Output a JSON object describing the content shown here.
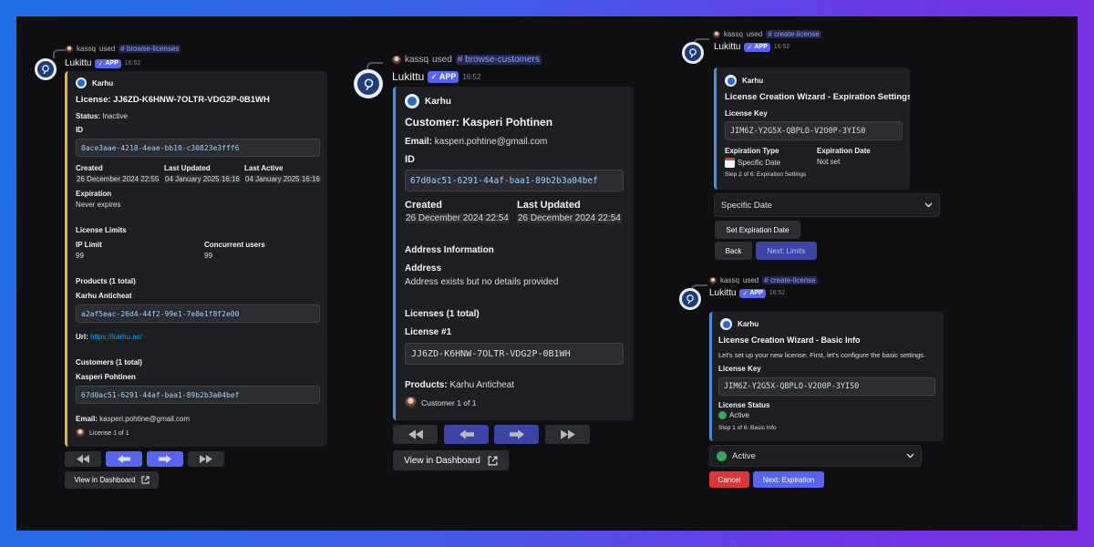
{
  "common": {
    "user": "kassq",
    "used_word": "used",
    "bot_name": "Lukittu",
    "app_badge": "APP",
    "embed_author": "Karhu",
    "time": "16:52"
  },
  "left": {
    "command": "browse-licenses",
    "title": "License: JJ6ZD-K6HNW-7OLTR-VDG2P-0B1WH",
    "status_label": "Status:",
    "status_value": "Inactive",
    "id_label": "ID",
    "id_value": "8ace3aae-4218-4eae-bb10-c30823e3fff6",
    "created_label": "Created",
    "created_value": "26 December 2024 22:55",
    "updated_label": "Last Updated",
    "updated_value": "04 January 2025 16:16",
    "active_label": "Last Active",
    "active_value": "04 January 2025 16:16",
    "expiration_label": "Expiration",
    "expiration_value": "Never expires",
    "limits_heading": "License Limits",
    "ip_limit_label": "IP Limit",
    "ip_limit_value": "99",
    "concurrent_label": "Concurrent users",
    "concurrent_value": "99",
    "products_heading": "Products (1 total)",
    "product_name": "Karhu Anticheat",
    "product_id": "a2af5eac-26d4-44f2-99e1-7e8e1f8f2e00",
    "url_label": "Url:",
    "url_value": "https://karhu.ac/",
    "customers_heading": "Customers (1 total)",
    "customer_name": "Kasperi Pohtinen",
    "customer_id": "67d0ac51-6291-44af-baa1-89b2b3a04bef",
    "email_label": "Email:",
    "email_value": "kasperi.pohtine@gmail.com",
    "footer": "License 1 of 1",
    "dashboard_button": "View in Dashboard"
  },
  "middle": {
    "command": "browse-customers",
    "title": "Customer: Kasperi Pohtinen",
    "email_label": "Email:",
    "email_value": "kasperi.pohtine@gmail.com",
    "id_label": "ID",
    "id_value": "67d0ac51-6291-44af-baa1-89b2b3a04bef",
    "created_label": "Created",
    "created_value": "26 December 2024 22:54",
    "updated_label": "Last Updated",
    "updated_value": "26 December 2024 22:54",
    "address_heading": "Address Information",
    "address_label": "Address",
    "address_value": "Address exists but no details provided",
    "licenses_heading": "Licenses (1 total)",
    "license_label": "License #1",
    "license_key": "JJ6ZD-K6HNW-7OLTR-VDG2P-0B1WH",
    "products_label": "Products:",
    "products_value": "Karhu Anticheat",
    "footer": "Customer 1 of 1",
    "dashboard_button": "View in Dashboard"
  },
  "right_top": {
    "command": "create-license",
    "title": "License Creation Wizard - Expiration Settings",
    "key_label": "License Key",
    "key_value": "JIM6Z-Y2G5X-QBPLO-V2O0P-3YIS0",
    "exp_type_label": "Expiration Type",
    "exp_type_value": "Specific Date",
    "exp_date_label": "Expiration Date",
    "exp_date_value": "Not set",
    "step": "Step 2 of 6: Expiration Settings",
    "select_value": "Specific Date",
    "set_button": "Set Expiration Date",
    "back_button": "Back",
    "next_button": "Next: Limits"
  },
  "right_bottom": {
    "command": "create-license",
    "title": "License Creation Wizard - Basic Info",
    "intro": "Let's set up your new license. First, let's configure the basic settings.",
    "key_label": "License Key",
    "key_value": "JIM6Z-Y2G5X-QBPLO-V2O0P-3YIS0",
    "status_label": "License Status",
    "status_value": "Active",
    "step": "Step 1 of 6: Basic Info",
    "select_value": "Active",
    "cancel_button": "Cancel",
    "next_button": "Next: Expiration"
  },
  "icons": {
    "first": "double-left-arrow-icon",
    "prev": "left-arrow-icon",
    "next": "right-arrow-icon",
    "last": "double-right-arrow-icon",
    "external": "external-link-icon",
    "chevron": "chevron-down-icon"
  },
  "colors": {
    "blurple": "#5865f2",
    "embed_yellow": "#e0b33a",
    "embed_blue": "#4a8fe0",
    "danger": "#da373c",
    "success": "#3ba55c"
  }
}
